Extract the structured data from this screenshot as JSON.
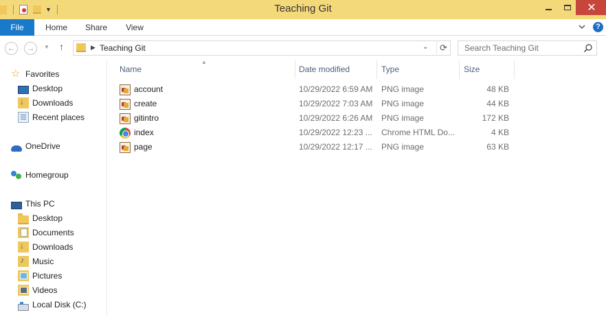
{
  "window": {
    "title": "Teaching Git"
  },
  "ribbon": {
    "tabs": [
      "File",
      "Home",
      "Share",
      "View"
    ],
    "help": "?"
  },
  "address": {
    "crumb": "Teaching Git",
    "search_placeholder": "Search Teaching Git"
  },
  "sidebar": {
    "favorites": {
      "label": "Favorites",
      "items": [
        "Desktop",
        "Downloads",
        "Recent places"
      ]
    },
    "onedrive": "OneDrive",
    "homegroup": "Homegroup",
    "thispc": {
      "label": "This PC",
      "items": [
        "Desktop",
        "Documents",
        "Downloads",
        "Music",
        "Pictures",
        "Videos",
        "Local Disk (C:)"
      ]
    }
  },
  "columns": {
    "name": "Name",
    "date": "Date modified",
    "type": "Type",
    "size": "Size"
  },
  "files": [
    {
      "name": "account",
      "date": "10/29/2022 6:59 AM",
      "type": "PNG image",
      "size": "48 KB",
      "icon": "png-file-icon"
    },
    {
      "name": "create",
      "date": "10/29/2022 7:03 AM",
      "type": "PNG image",
      "size": "44 KB",
      "icon": "png-file-icon"
    },
    {
      "name": "gitintro",
      "date": "10/29/2022 6:26 AM",
      "type": "PNG image",
      "size": "172 KB",
      "icon": "png-file-icon"
    },
    {
      "name": "index",
      "date": "10/29/2022 12:23 ...",
      "type": "Chrome HTML Do...",
      "size": "4 KB",
      "icon": "chrome-html-icon"
    },
    {
      "name": "page",
      "date": "10/29/2022 12:17 ...",
      "type": "PNG image",
      "size": "63 KB",
      "icon": "png-file-icon"
    }
  ],
  "colors": {
    "titlebar": "#f4d97a",
    "file_tab": "#1979ca",
    "close_button": "#c7463c",
    "column_header_text": "#4c607a"
  }
}
